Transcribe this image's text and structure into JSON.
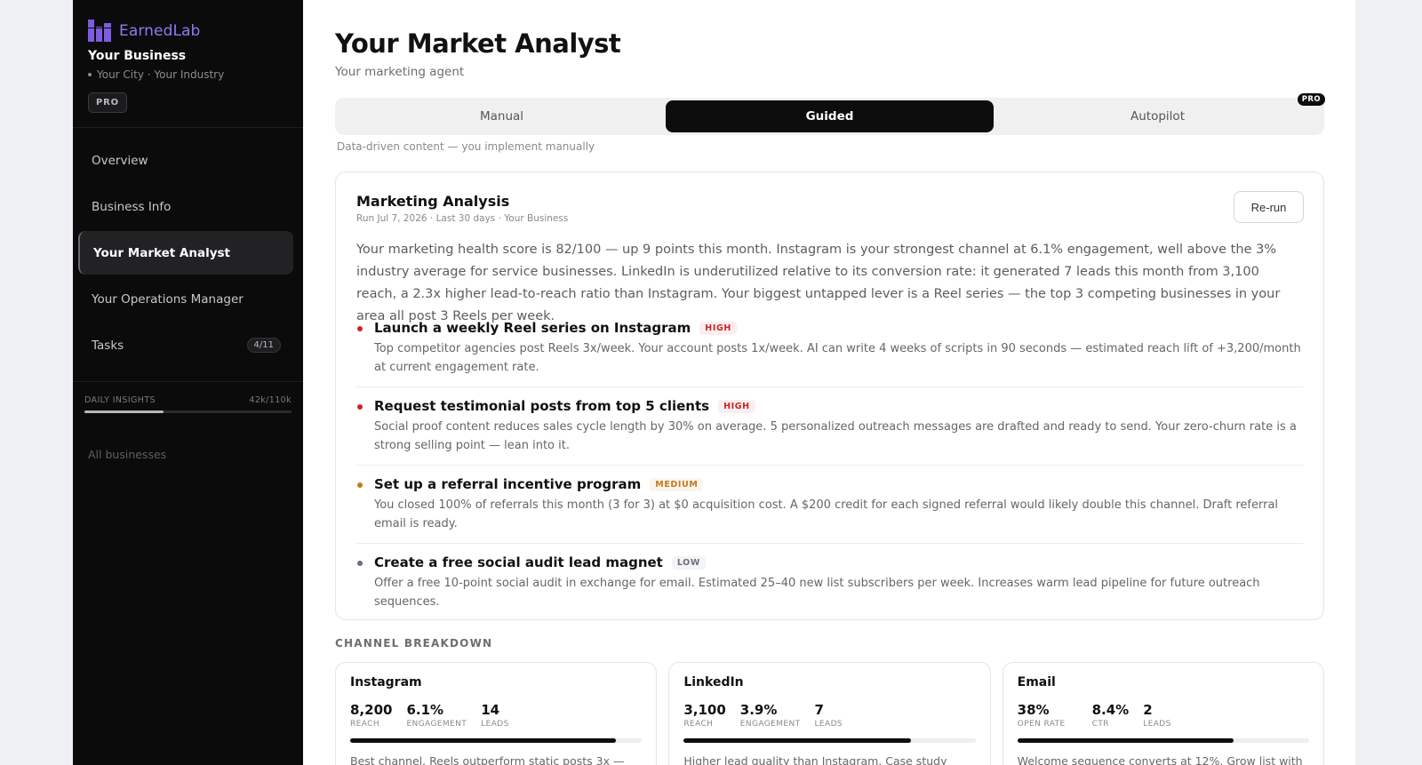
{
  "sidebar": {
    "brand": "EarnedLab",
    "business_name": "Your Business",
    "business_meta": "Your City · Your Industry",
    "plan_badge": "PRO",
    "nav": [
      {
        "label": "Overview",
        "active": false
      },
      {
        "label": "Business Info",
        "active": false
      },
      {
        "label": "Your Market Analyst",
        "active": true
      },
      {
        "label": "Your Operations Manager",
        "active": false
      },
      {
        "label": "Tasks",
        "active": false,
        "count": "4/11"
      }
    ],
    "insights": {
      "label": "DAILY INSIGHTS",
      "usage": "42k/110k",
      "fraction": 0.38
    },
    "all_businesses": "All businesses"
  },
  "header": {
    "title": "Your Market Analyst",
    "subtitle": "Your marketing agent"
  },
  "modes": {
    "options": [
      "Manual",
      "Guided",
      "Autopilot"
    ],
    "selected": "Guided",
    "pro_badge": "PRO",
    "hint": "Data-driven content — you implement manually"
  },
  "analysis": {
    "title": "Marketing Analysis",
    "meta": "Run Jul 7, 2026 · Last 30 days · Your Business",
    "rerun_label": "Re-run",
    "summary": "Your marketing health score is 82/100 — up 9 points this month. Instagram is your strongest channel at 6.1% engagement, well above the 3% industry average for service businesses. LinkedIn is underutilized relative to its conversion rate: it generated 7 leads this month from 3,100 reach, a 2.3x higher lead-to-reach ratio than Instagram. Your biggest untapped lever is a Reel series — the top 3 competing businesses in your area all post 3 Reels per week.",
    "recommendations": [
      {
        "title": "Launch a weekly Reel series on Instagram",
        "priority": "HIGH",
        "color": "#c62828",
        "body": "Top competitor agencies post Reels 3x/week. Your account posts 1x/week. AI can write 4 weeks of scripts in 90 seconds — estimated reach lift of +3,200/month at current engagement rate."
      },
      {
        "title": "Request testimonial posts from top 5 clients",
        "priority": "HIGH",
        "color": "#c62828",
        "body": "Social proof content reduces sales cycle length by 30% on average. 5 personalized outreach messages are drafted and ready to send. Your zero-churn rate is a strong selling point — lean into it."
      },
      {
        "title": "Set up a referral incentive program",
        "priority": "MEDIUM",
        "color": "#c27a1a",
        "body": "You closed 100% of referrals this month (3 for 3) at $0 acquisition cost. A $200 credit for each signed referral would likely double this channel. Draft referral email is ready."
      },
      {
        "title": "Create a free social audit lead magnet",
        "priority": "LOW",
        "color": "#6b6f80",
        "body": "Offer a free 10-point social audit in exchange for email. Estimated 25–40 new list subscribers per week. Increases warm lead pipeline for future outreach sequences."
      }
    ]
  },
  "channels": {
    "label": "CHANNEL BREAKDOWN",
    "items": [
      {
        "name": "Instagram",
        "stats": [
          {
            "value": "8,200",
            "label": "REACH"
          },
          {
            "value": "6.1%",
            "label": "ENGAGEMENT"
          },
          {
            "value": "14",
            "label": "LEADS"
          }
        ],
        "progress": 0.91,
        "note": "Best channel. Reels outperform static posts 3x —"
      },
      {
        "name": "LinkedIn",
        "stats": [
          {
            "value": "3,100",
            "label": "REACH"
          },
          {
            "value": "3.9%",
            "label": "ENGAGEMENT"
          },
          {
            "value": "7",
            "label": "LEADS"
          }
        ],
        "progress": 0.78,
        "note": "Higher lead quality than Instagram. Case study posts get"
      },
      {
        "name": "Email",
        "stats": [
          {
            "value": "38%",
            "label": "OPEN RATE"
          },
          {
            "value": "8.4%",
            "label": "CTR"
          },
          {
            "value": "2",
            "label": "LEADS"
          }
        ],
        "progress": 0.74,
        "note": "Welcome sequence converts at 12%. Grow list with lead"
      }
    ]
  }
}
